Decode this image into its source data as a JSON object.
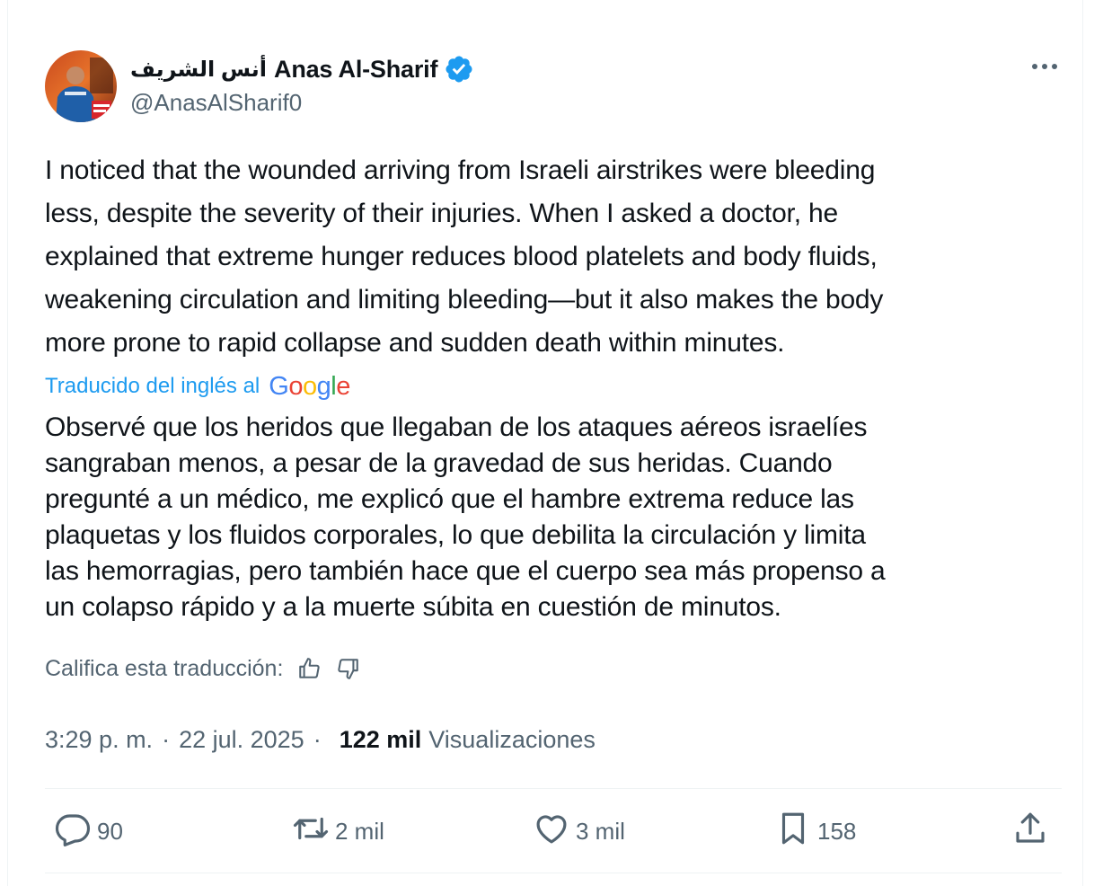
{
  "tweet": {
    "author": {
      "name_arabic": "أنس الشريف",
      "name": "Anas Al-Sharif",
      "handle": "@AnasAlSharif0",
      "verified": true
    },
    "text_lines": [
      "I noticed that the wounded arriving from Israeli airstrikes were bleeding",
      "less, despite the severity of their injuries. When I asked a doctor, he",
      "explained that extreme hunger reduces blood platelets and body fluids,",
      "weakening circulation and limiting bleeding—but it also makes the body",
      "more prone to rapid collapse and sudden death within minutes."
    ],
    "translation_label": "Traducido del inglés al",
    "translation_provider": "Google",
    "translation_lines": [
      "Observé que los heridos que llegaban de los ataques aéreos israelíes",
      "sangraban menos, a pesar de la gravedad de sus heridas. Cuando",
      "pregunté a un médico, me explicó que el hambre extrema reduce las",
      "plaquetas y los fluidos corporales, lo que debilita la circulación y limita",
      "las hemorragias, pero también hace que el cuerpo sea más propenso a",
      "un colapso rápido y a la muerte súbita en cuestión de minutos."
    ],
    "rate_label": "Califica esta traducción:",
    "time": "3:29 p. m.",
    "date": "22 jul. 2025",
    "separator": "·",
    "views_count": "122 mil",
    "views_label": "Visualizaciones",
    "actions": {
      "replies": "90",
      "reposts": "2 mil",
      "likes": "3 mil",
      "bookmarks": "158"
    }
  },
  "icons": {
    "verified": "verified-badge-icon",
    "more": "more-options-icon",
    "thumbs_up": "thumbs-up-icon",
    "thumbs_down": "thumbs-down-icon",
    "reply": "reply-icon",
    "repost": "repost-icon",
    "like": "heart-icon",
    "bookmark": "bookmark-icon",
    "share": "share-icon"
  },
  "colors": {
    "text_primary": "#0f1419",
    "text_secondary": "#536471",
    "accent": "#1d9bf0",
    "divider": "#eff3f4"
  }
}
